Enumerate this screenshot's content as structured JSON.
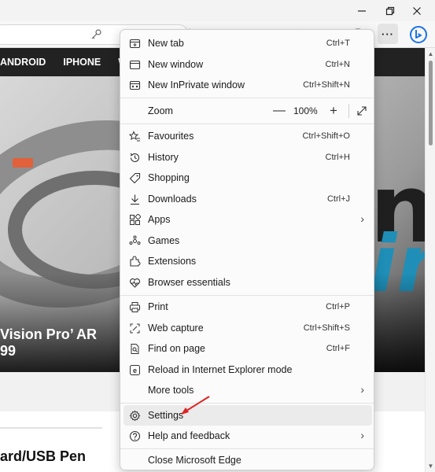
{
  "window": {
    "minimize_icon": "minimize-icon",
    "maximize_icon": "restore-icon",
    "close_icon": "close-icon"
  },
  "toolbar": {
    "more_label": "···",
    "icons": [
      "key-icon",
      "tab-actions-icon",
      "favorites-star-icon",
      "extensions-icon",
      "collections-icon",
      "profile-icon",
      "bing-icon"
    ]
  },
  "page": {
    "nav": [
      "ANDROID",
      "IPHONE",
      "WI"
    ],
    "hero_title_line1": "Vision Pro’ AR",
    "hero_title_line2": "99",
    "hero_big_text1": "n",
    "hero_big_text2": "in",
    "article_title": "ard/USB Pen"
  },
  "menu": {
    "new_tab": {
      "label": "New tab",
      "shortcut": "Ctrl+T"
    },
    "new_window": {
      "label": "New window",
      "shortcut": "Ctrl+N"
    },
    "new_inprivate": {
      "label": "New InPrivate window",
      "shortcut": "Ctrl+Shift+N"
    },
    "zoom": {
      "label": "Zoom",
      "minus": "—",
      "value": "100%",
      "plus": "+"
    },
    "favourites": {
      "label": "Favourites",
      "shortcut": "Ctrl+Shift+O"
    },
    "history": {
      "label": "History",
      "shortcut": "Ctrl+H"
    },
    "shopping": {
      "label": "Shopping"
    },
    "downloads": {
      "label": "Downloads",
      "shortcut": "Ctrl+J"
    },
    "apps": {
      "label": "Apps"
    },
    "games": {
      "label": "Games"
    },
    "extensions": {
      "label": "Extensions"
    },
    "browser_essentials": {
      "label": "Browser essentials"
    },
    "print": {
      "label": "Print",
      "shortcut": "Ctrl+P"
    },
    "web_capture": {
      "label": "Web capture",
      "shortcut": "Ctrl+Shift+S"
    },
    "find_on_page": {
      "label": "Find on page",
      "shortcut": "Ctrl+F"
    },
    "reload_ie": {
      "label": "Reload in Internet Explorer mode"
    },
    "more_tools": {
      "label": "More tools"
    },
    "settings": {
      "label": "Settings"
    },
    "help": {
      "label": "Help and feedback"
    },
    "close_edge": {
      "label": "Close Microsoft Edge"
    }
  },
  "colors": {
    "accent_arrow": "#e02020",
    "bing_blue": "#1a73e8",
    "menu_bg": "#fbfbfb",
    "highlight": "#ebebeb"
  }
}
